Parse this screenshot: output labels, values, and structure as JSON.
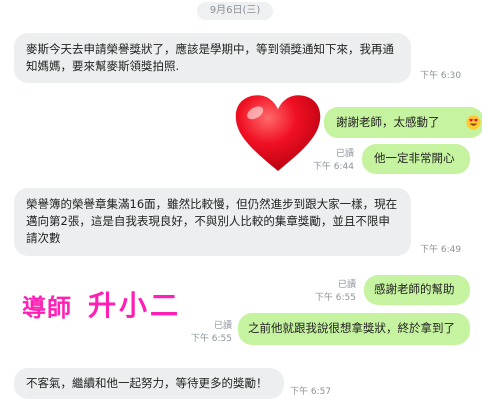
{
  "date_divider": "9月6日(三)",
  "messages": [
    {
      "text": "麥斯今天去申請榮譽獎狀了，應該是學期中，等到領獎通知下來，我再通知媽媽，要來幫麥斯領獎拍照.",
      "time": "下午 6:30"
    },
    {
      "text": "謝謝老師，太感動了",
      "emoji": "smiling-face-with-heart-eyes"
    },
    {
      "text": "他一定非常開心",
      "read": "已讀",
      "time": "下午 6:44"
    },
    {
      "text": "榮譽簿的榮譽章集滿16面，雖然比較慢，但仍然進步到跟大家一樣，現在邁向第2張，這是自我表現良好，不與別人比較的集章獎勵，並且不限申請次數",
      "time": "下午 6:49"
    },
    {
      "text": "感謝老師的幫助",
      "read": "已讀",
      "time": "下午 6:55"
    },
    {
      "text": "之前他就跟我說很想拿獎狀，終於拿到了",
      "read": "已讀",
      "time": "下午 6:55"
    },
    {
      "text": "不客氣，繼續和他一起努力，等待更多的獎勵！",
      "time": "下午 6:57"
    }
  ],
  "sticker": {
    "name": "red-heart",
    "color": "#e8001c"
  },
  "signature": {
    "role": "導師",
    "name": "升小二",
    "color": "#ff1fb4"
  }
}
